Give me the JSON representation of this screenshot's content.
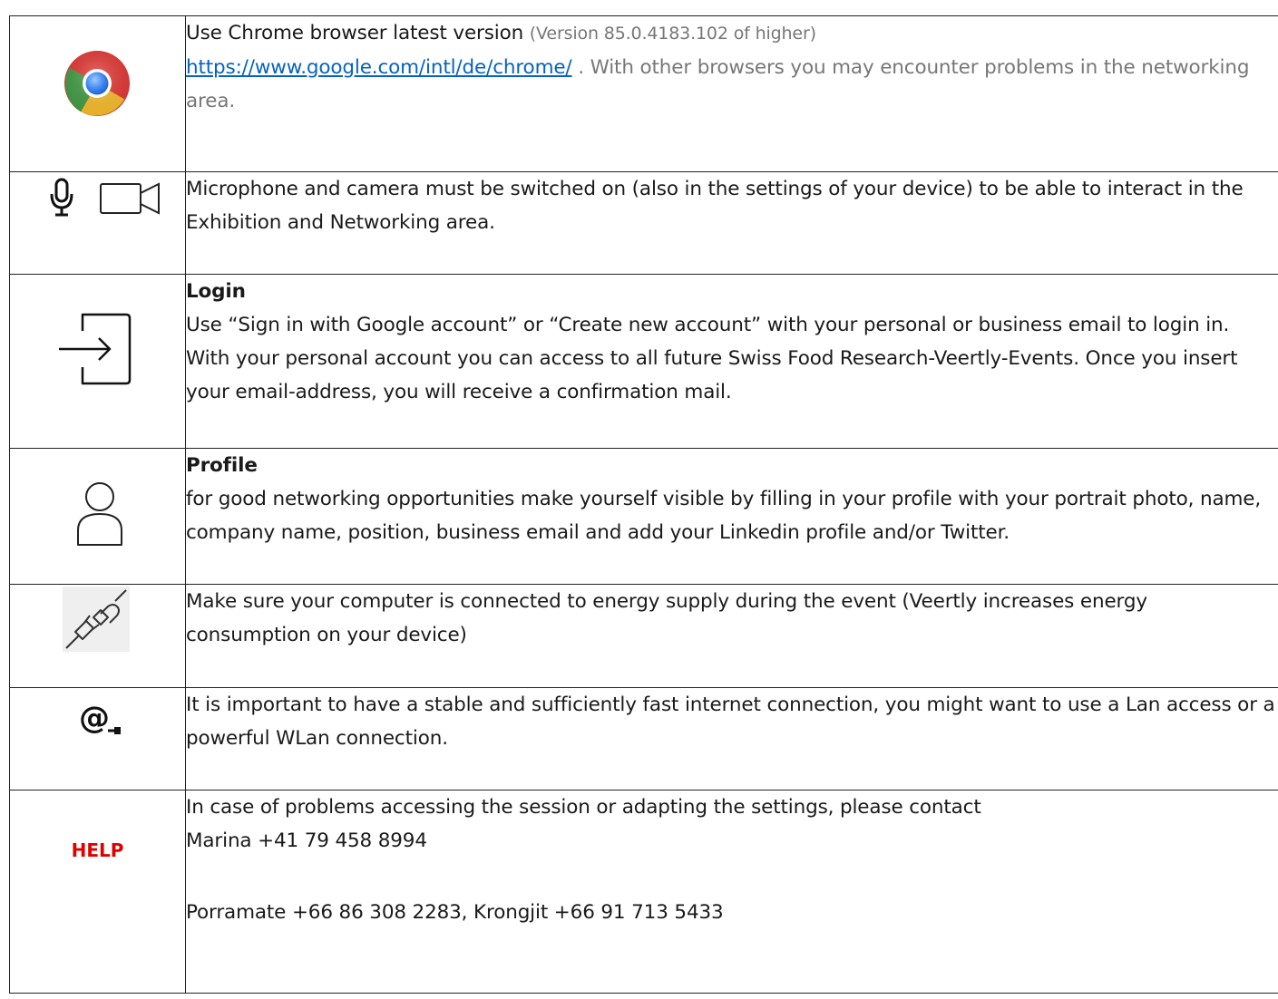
{
  "rows": [
    {
      "icon": "chrome-browser-icon",
      "line1_main": "Use Chrome browser latest version ",
      "line1_gray": "(Version 85.0.4183.102 of higher)",
      "link_text": "https://www.google.com/intl/de/chrome/",
      "line2_gray": " . With other browsers you may encounter problems in the networking area."
    },
    {
      "icon": "microphone-icon, video-camera-icon",
      "text": "Microphone and camera must be switched on (also in the settings of your device) to be able to interact in the Exhibition and Networking area."
    },
    {
      "icon": "login-icon",
      "heading": "Login",
      "text": "Use “Sign in with Google account” or “Create new account” with your personal or business email to login in. With your personal account you can access to all future Swiss Food Research-Veertly-Events. Once you insert your email-address, you will receive a confirmation mail."
    },
    {
      "icon": "profile-user-icon",
      "heading": "Profile",
      "text": "for good networking opportunities make yourself visible by filling in your profile with your portrait photo, name, company name, position, business email and add your Linkedin profile and/or Twitter."
    },
    {
      "icon": "power-plug-icon",
      "text": "Make sure your computer is connected to energy supply during the event (Veertly increases energy consumption on your device)"
    },
    {
      "icon": "at-sign-icon",
      "text": "It is important to have a stable and sufficiently fast internet connection, you might want to use a Lan access or a powerful WLan connection."
    },
    {
      "icon_label": "HELP",
      "line1": "In case of problems accessing the session or adapting the settings, please contact",
      "line2": "Marina +41 79 458 8994",
      "line3": "Porramate +66 86 308 2283, Krongjit +66 91 713 5433"
    }
  ]
}
